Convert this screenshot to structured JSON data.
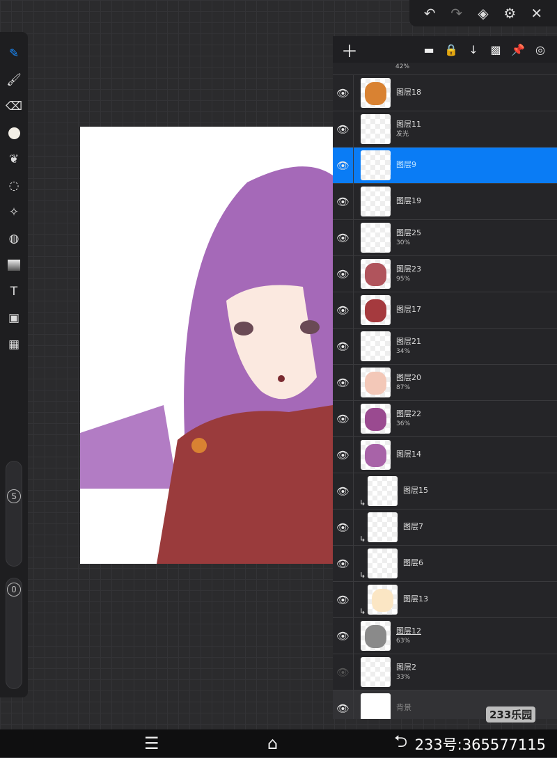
{
  "topbar": {
    "icons": [
      "undo-icon",
      "redo-icon",
      "layers-icon",
      "gear-icon",
      "close-icon"
    ]
  },
  "tools": [
    "brush",
    "smudge",
    "eraser",
    "color",
    "leaf-brush",
    "lasso",
    "magic-wand",
    "fill",
    "gradient",
    "text",
    "image",
    "grid"
  ],
  "sliders": {
    "size_label": "S",
    "opacity_label": "0"
  },
  "panel": {
    "header_icons": [
      "add-layer",
      "folder",
      "lock",
      "merge-down",
      "checkerboard",
      "pin",
      "target"
    ],
    "partial_top": {
      "opacity": "42%"
    },
    "layers": [
      {
        "name": "图层18",
        "opacity": "",
        "visible": true,
        "color": "#d98232"
      },
      {
        "name": "图层11",
        "opacity": "发光",
        "visible": true,
        "color": ""
      },
      {
        "name": "图层9",
        "opacity": "",
        "visible": true,
        "color": "",
        "selected": true
      },
      {
        "name": "图层19",
        "opacity": "",
        "visible": true,
        "color": ""
      },
      {
        "name": "图层25",
        "opacity": "30%",
        "visible": true,
        "color": ""
      },
      {
        "name": "图层23",
        "opacity": "95%",
        "visible": true,
        "color": "#b0545c"
      },
      {
        "name": "图层17",
        "opacity": "",
        "visible": true,
        "color": "#a53a3e"
      },
      {
        "name": "图层21",
        "opacity": "34%",
        "visible": true,
        "color": ""
      },
      {
        "name": "图层20",
        "opacity": "87%",
        "visible": true,
        "color": "#f3c8b8"
      },
      {
        "name": "图层22",
        "opacity": "36%",
        "visible": true,
        "color": "#9a4a90"
      },
      {
        "name": "图层14",
        "opacity": "",
        "visible": true,
        "color": "#a863a8"
      },
      {
        "name": "图层15",
        "opacity": "",
        "visible": true,
        "clip": true
      },
      {
        "name": "图层7",
        "opacity": "",
        "visible": true,
        "clip": true
      },
      {
        "name": "图层6",
        "opacity": "",
        "visible": true,
        "clip": true
      },
      {
        "name": "图层13",
        "opacity": "",
        "visible": true,
        "clip": true,
        "color": "#fbe6c4"
      },
      {
        "name": "图层12",
        "opacity": "63%",
        "visible": true,
        "color": "#8a8a8a",
        "underline": true
      },
      {
        "name": "图层2",
        "opacity": "33%",
        "visible": false
      },
      {
        "name": "背景",
        "opacity": "",
        "visible": true,
        "background": true
      }
    ]
  },
  "watermark": "233乐园",
  "user_id": "233号:365577115",
  "colors": {
    "accent": "#0a7cf5",
    "hair": "#a569b8",
    "sweater": "#9a3b3c"
  }
}
